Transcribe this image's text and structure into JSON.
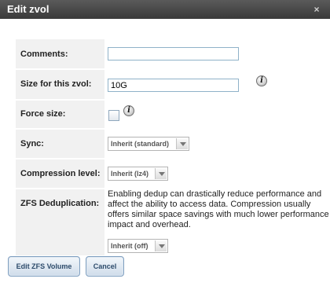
{
  "dialog": {
    "title": "Edit zvol",
    "close_glyph": "×"
  },
  "fields": {
    "comments": {
      "label": "Comments:",
      "value": ""
    },
    "size": {
      "label": "Size for this zvol:",
      "value": "10G"
    },
    "force_size": {
      "label": "Force size:",
      "checked": false
    },
    "sync": {
      "label": "Sync:",
      "selected": "Inherit (standard)"
    },
    "compression": {
      "label": "Compression level:",
      "selected": "Inherit (lz4)"
    },
    "dedup": {
      "label": "ZFS Deduplication:",
      "description": "Enabling dedup can drastically reduce performance and affect the ability to access data. Compression usually offers similar space savings with much lower performance impact and overhead.",
      "selected": "Inherit (off)"
    }
  },
  "icons": {
    "info": "info-icon",
    "info_glyph": "i"
  },
  "buttons": {
    "submit": "Edit ZFS Volume",
    "cancel": "Cancel"
  },
  "colors": {
    "titlebar": "#4a4a4a",
    "label_bg": "#f1f1f1",
    "button_text": "#2d4b6b"
  }
}
